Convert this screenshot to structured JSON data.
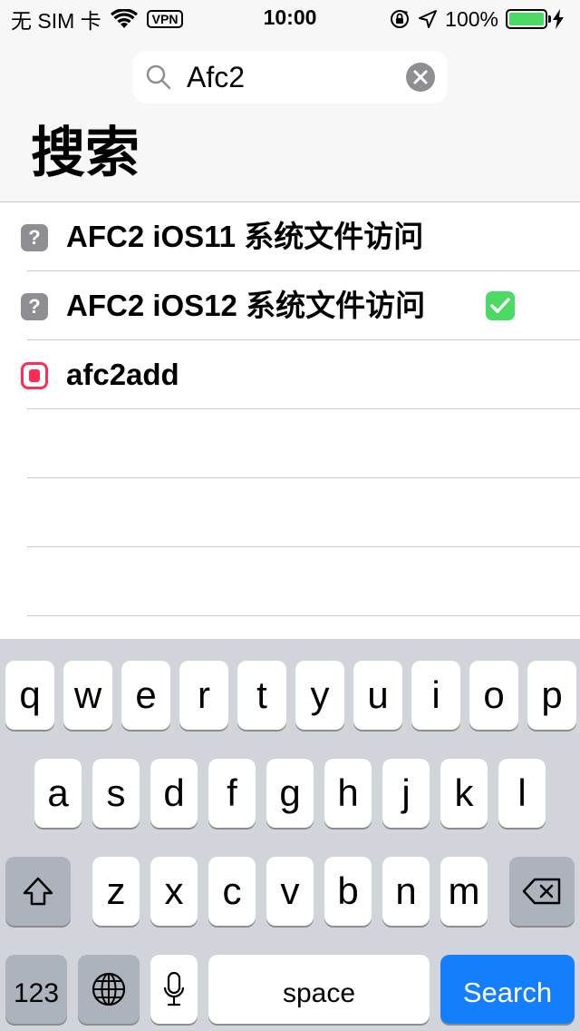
{
  "status_bar": {
    "carrier": "无 SIM 卡",
    "vpn": "VPN",
    "time": "10:00",
    "battery_percent": "100%",
    "battery_level": 1.0,
    "battery_color": "#4cd964"
  },
  "search": {
    "query": "Afc2",
    "title": "搜索"
  },
  "results": [
    {
      "label": "AFC2 iOS11 系统文件访问",
      "icon": "question-icon",
      "icon_glyph": "?",
      "installed": false
    },
    {
      "label": "AFC2 iOS12 系统文件访问",
      "icon": "question-icon",
      "icon_glyph": "?",
      "installed": true
    },
    {
      "label": "afc2add",
      "icon": "package-icon",
      "installed": false
    }
  ],
  "keyboard": {
    "row1": [
      "q",
      "w",
      "e",
      "r",
      "t",
      "y",
      "u",
      "i",
      "o",
      "p"
    ],
    "row2": [
      "a",
      "s",
      "d",
      "f",
      "g",
      "h",
      "j",
      "k",
      "l"
    ],
    "row3": [
      "z",
      "x",
      "c",
      "v",
      "b",
      "n",
      "m"
    ],
    "numbers_label": "123",
    "space_label": "space",
    "return_label": "Search",
    "return_color": "#147efb"
  }
}
